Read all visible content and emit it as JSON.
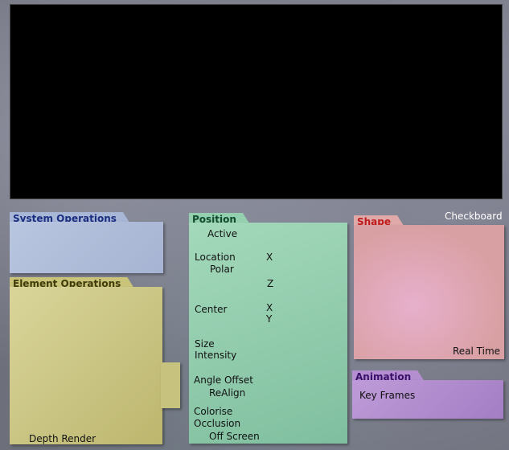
{
  "system_operations": {
    "title": "System Operations"
  },
  "element_operations": {
    "title": "Element Operations",
    "depth_render": "Depth Render"
  },
  "position": {
    "title": "Position",
    "active": "Active",
    "location": "Location",
    "polar": "Polar",
    "x1": "X",
    "z": "Z",
    "center": "Center",
    "x2": "X",
    "y": "Y",
    "size": "Size",
    "intensity": "Intensity",
    "angle_offset": "Angle Offset",
    "realign": "ReAlign",
    "colorise": "Colorise",
    "occlusion": "Occlusion",
    "off_screen": "Off Screen"
  },
  "shape": {
    "title": "Shape",
    "checkboard": "Checkboard",
    "real_time": "Real Time"
  },
  "animation": {
    "title": "Animation",
    "key_frames": "Key Frames"
  }
}
